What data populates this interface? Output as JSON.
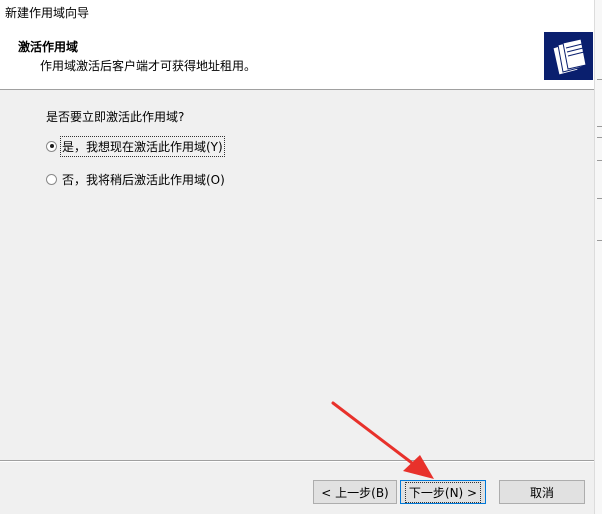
{
  "window": {
    "title": "新建作用域向导"
  },
  "header": {
    "title": "激活作用域",
    "subtitle": "作用域激活后客户端才可获得地址租用。",
    "icon": "folder-stack-icon"
  },
  "content": {
    "question": "是否要立即激活此作用域?",
    "options": [
      {
        "label": "是，我想现在激活此作用域(Y)",
        "selected": true
      },
      {
        "label": "否，我将稍后激活此作用域(O)",
        "selected": false
      }
    ]
  },
  "buttons": {
    "back": "< 上一步(B)",
    "next": "下一步(N) >",
    "cancel": "取消"
  },
  "colors": {
    "header_icon_bg": "#0a1f6e",
    "annotation_arrow": "#e8312b",
    "default_button_border": "#0078d7"
  }
}
